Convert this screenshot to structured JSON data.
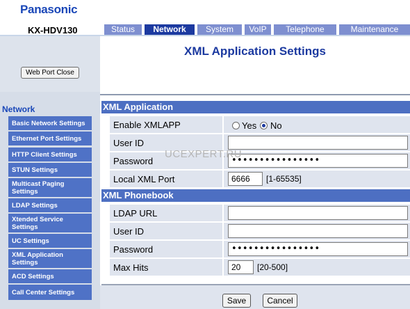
{
  "brand": "Panasonic",
  "model": "KX-HDV130",
  "tabs": [
    {
      "label": "Status"
    },
    {
      "label": "Network"
    },
    {
      "label": "System"
    },
    {
      "label": "VoIP"
    },
    {
      "label": "Telephone"
    },
    {
      "label": "Maintenance"
    }
  ],
  "web_port_button": "Web Port Close",
  "nav": {
    "heading": "Network",
    "items": [
      {
        "label": "Basic Network Settings"
      },
      {
        "label": "Ethernet Port Settings"
      },
      {
        "label": "HTTP Client Settings"
      },
      {
        "label": "STUN Settings"
      },
      {
        "label": "Multicast Paging Settings"
      },
      {
        "label": "LDAP Settings"
      },
      {
        "label": "Xtended Service Settings"
      },
      {
        "label": "UC Settings"
      },
      {
        "label": "XML Application Settings"
      },
      {
        "label": "ACD Settings"
      },
      {
        "label": "Call Center Settings"
      }
    ]
  },
  "page_title": "XML Application Settings",
  "xml_application": {
    "heading": "XML Application",
    "enable_label": "Enable XMLAPP",
    "yes_label": "Yes",
    "no_label": "No",
    "selected": "No",
    "user_id_label": "User ID",
    "user_id_value": "",
    "password_label": "Password",
    "password_value": "••••••••••••••••",
    "port_label": "Local XML Port",
    "port_value": "6666",
    "port_range": "[1-65535]"
  },
  "xml_phonebook": {
    "heading": "XML Phonebook",
    "ldap_url_label": "LDAP URL",
    "ldap_url_value": "",
    "user_id_label": "User ID",
    "user_id_value": "",
    "password_label": "Password",
    "password_value": "••••••••••••••••",
    "max_hits_label": "Max Hits",
    "max_hits_value": "20",
    "max_hits_range": "[20-500]"
  },
  "footer": {
    "save_label": "Save",
    "cancel_label": "Cancel"
  },
  "watermark": "UCEXPERT.RU",
  "colors": {
    "brand_blue": "#1a47b8",
    "tab_active": "#1c3aa0",
    "tab_inactive": "#7e8fd0",
    "section_header": "#4d6fc2",
    "nav_item": "#4f72c6",
    "row_background": "#dfe4ee"
  }
}
